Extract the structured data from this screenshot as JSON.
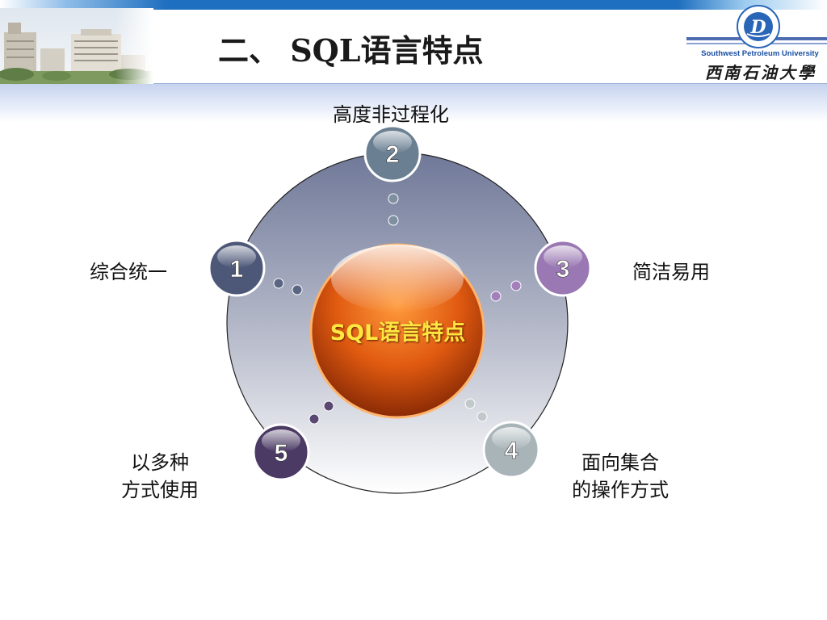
{
  "header": {
    "title": "二、 SQL语言特点",
    "university_en": "Southwest Petroleum University",
    "university_cn": "西南石油大學"
  },
  "diagram": {
    "center_label": "SQL语言特点",
    "nodes": [
      {
        "number": "1",
        "label_line1": "综合统一",
        "label_line2": "",
        "color": "#4d5878"
      },
      {
        "number": "2",
        "label_line1": "高度非过程化",
        "label_line2": "",
        "color": "#6a7f92"
      },
      {
        "number": "3",
        "label_line1": "简洁易用",
        "label_line2": "",
        "color": "#9a78b3"
      },
      {
        "number": "4",
        "label_line1": "面向集合",
        "label_line2": "的操作方式",
        "color": "#a9b4b9"
      },
      {
        "number": "5",
        "label_line1": "以多种",
        "label_line2": "方式使用",
        "color": "#4b3a64"
      }
    ]
  },
  "colors": {
    "brand_blue": "#1f6fc0",
    "center_orange": "#e05a10"
  }
}
